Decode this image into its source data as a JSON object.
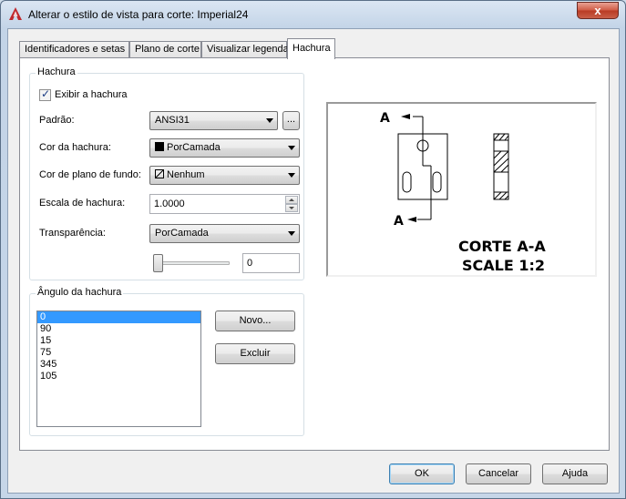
{
  "window": {
    "title": "Alterar o estilo de vista para corte: Imperial24",
    "close_glyph": "x"
  },
  "tabs": [
    {
      "label": "Identificadores e setas",
      "active": false
    },
    {
      "label": "Plano de corte",
      "active": false
    },
    {
      "label": "Visualizar legenda",
      "active": false
    },
    {
      "label": "Hachura",
      "active": true
    }
  ],
  "hatch": {
    "group_title": "Hachura",
    "show_hatch_label": "Exibir a hachura",
    "show_hatch_checked": true,
    "pattern_label": "Padrão:",
    "pattern_value": "ANSI31",
    "browse_label": "...",
    "color_label": "Cor da hachura:",
    "color_value": "PorCamada",
    "bg_color_label": "Cor de plano de fundo:",
    "bg_color_value": "Nenhum",
    "scale_label": "Escala de hachura:",
    "scale_value": "1.0000",
    "transparency_label": "Transparência:",
    "transparency_value": "PorCamada",
    "transparency_amount": "0"
  },
  "angle": {
    "group_title": "Ângulo da hachura",
    "items": [
      "0",
      "90",
      "15",
      "75",
      "345",
      "105"
    ],
    "selected_index": 0,
    "new_label": "Novo...",
    "delete_label": "Excluir"
  },
  "preview": {
    "label_top": "A",
    "label_bottom": "A",
    "caption_line1": "CORTE A-A",
    "caption_line2": "SCALE 1:2"
  },
  "footer": {
    "ok_label": "OK",
    "cancel_label": "Cancelar",
    "help_label": "Ajuda"
  },
  "colors": {
    "selection": "#3399ff",
    "close_button": "#c95f48",
    "app_icon": "#c0282d"
  },
  "icons": {
    "app": "autocad-a-icon",
    "close": "close-icon",
    "dropdown": "chevron-down-icon",
    "spin": "spin-arrows-icon"
  }
}
